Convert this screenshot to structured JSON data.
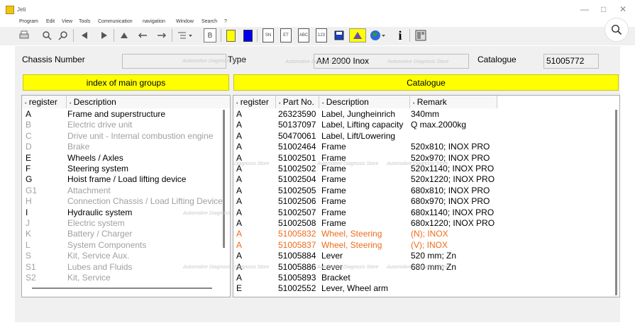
{
  "window": {
    "title": "Jeti",
    "minimize": "—",
    "restore": "□",
    "close": "✕"
  },
  "menu": [
    "Program",
    "Edit",
    "View",
    "Tools",
    "Communication",
    "navigation",
    "Window",
    "Search",
    "?"
  ],
  "toolbar": {
    "label_sn": "SN",
    "label_et": "ET",
    "label_abc": "ABC",
    "label_123": "123",
    "label_info": "i",
    "label_b": "B"
  },
  "search_icon": "search-icon",
  "header": {
    "chassis_label": "Chassis Number",
    "chassis_value": "",
    "type_label": "Type",
    "type_value": "AM 2000 Inox",
    "catalogue_label": "Catalogue",
    "catalogue_value": "51005772"
  },
  "watermark": "Automotive Diagnosis Store",
  "left_panel": {
    "title": "index of main groups",
    "col_register": "register",
    "col_description": "Description",
    "rows": [
      {
        "register": "A",
        "description": "Frame and superstructure",
        "active": true
      },
      {
        "register": "B",
        "description": "Electric drive unit",
        "active": false
      },
      {
        "register": "C",
        "description": "Drive unit - Internal combustion engine",
        "active": false
      },
      {
        "register": "D",
        "description": "Brake",
        "active": false
      },
      {
        "register": "E",
        "description": "Wheels / Axles",
        "active": true
      },
      {
        "register": "F",
        "description": "Steering system",
        "active": true
      },
      {
        "register": "G",
        "description": "Hoist frame / Load lifting device",
        "active": true
      },
      {
        "register": "G1",
        "description": "Attachment",
        "active": false
      },
      {
        "register": "H",
        "description": "Connection Chassis / Load Lifting Device",
        "active": false
      },
      {
        "register": "I",
        "description": "Hydraulic system",
        "active": true
      },
      {
        "register": "J",
        "description": "Electric system",
        "active": false
      },
      {
        "register": "K",
        "description": "Battery / Charger",
        "active": false
      },
      {
        "register": "L",
        "description": "System Components",
        "active": false
      },
      {
        "register": "S",
        "description": "Kit, Service Aux.",
        "active": false
      },
      {
        "register": "S1",
        "description": "Lubes and Fluids",
        "active": false
      },
      {
        "register": "S2",
        "description": "Kit, Service",
        "active": false
      }
    ]
  },
  "right_panel": {
    "title": "Catalogue",
    "col_register": "register",
    "col_partno": "Part No.",
    "col_description": "Description",
    "col_remark": "Remark",
    "rows": [
      {
        "register": "A",
        "partno": "26323590",
        "description": "Label, Jungheinrich",
        "remark": "340mm",
        "highlight": false
      },
      {
        "register": "A",
        "partno": "50137097",
        "description": "Label, Lifting capacity",
        "remark": "Q max.2000kg",
        "highlight": false
      },
      {
        "register": "A",
        "partno": "50470061",
        "description": "Label, Lift/Lowering",
        "remark": "",
        "highlight": false
      },
      {
        "register": "A",
        "partno": "51002464",
        "description": "Frame",
        "remark": "520x810; INOX PRO",
        "highlight": false
      },
      {
        "register": "A",
        "partno": "51002501",
        "description": "Frame",
        "remark": "520x970; INOX PRO",
        "highlight": false
      },
      {
        "register": "A",
        "partno": "51002502",
        "description": "Frame",
        "remark": "520x1140; INOX PRO",
        "highlight": false
      },
      {
        "register": "A",
        "partno": "51002504",
        "description": "Frame",
        "remark": "520x1220; INOX PRO",
        "highlight": false
      },
      {
        "register": "A",
        "partno": "51002505",
        "description": "Frame",
        "remark": "680x810; INOX PRO",
        "highlight": false
      },
      {
        "register": "A",
        "partno": "51002506",
        "description": "Frame",
        "remark": "680x970; INOX PRO",
        "highlight": false
      },
      {
        "register": "A",
        "partno": "51002507",
        "description": "Frame",
        "remark": "680x1140; INOX PRO",
        "highlight": false
      },
      {
        "register": "A",
        "partno": "51002508",
        "description": "Frame",
        "remark": "680x1220; INOX PRO",
        "highlight": false
      },
      {
        "register": "A",
        "partno": "51005832",
        "description": "Wheel, Steering",
        "remark": "(N); INOX",
        "highlight": true
      },
      {
        "register": "A",
        "partno": "51005837",
        "description": "Wheel, Steering",
        "remark": "(V); INOX",
        "highlight": true
      },
      {
        "register": "A",
        "partno": "51005884",
        "description": "Lever",
        "remark": "520 mm; Zn",
        "highlight": false
      },
      {
        "register": "A",
        "partno": "51005886",
        "description": "Lever",
        "remark": "680 mm; Zn",
        "highlight": false
      },
      {
        "register": "A",
        "partno": "51005893",
        "description": "Bracket",
        "remark": "",
        "highlight": false
      },
      {
        "register": "E",
        "partno": "51002552",
        "description": "Lever, Wheel arm",
        "remark": "",
        "highlight": false
      }
    ]
  },
  "colors": {
    "header_yellow": "#ffff00",
    "highlight_orange": "#f06a18",
    "inactive_gray": "#a0a0a0"
  }
}
